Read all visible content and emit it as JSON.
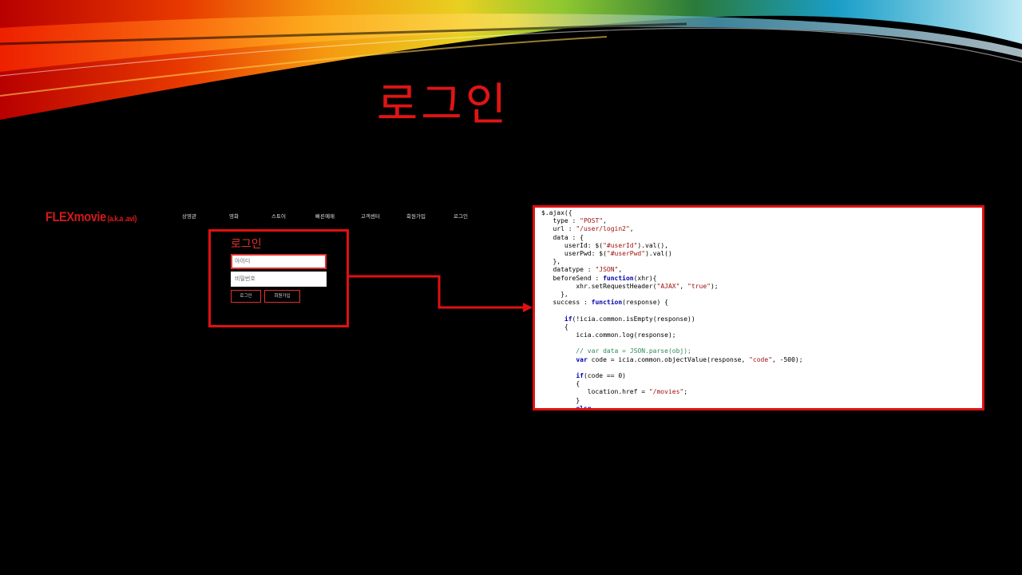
{
  "slide": {
    "title": "로그인"
  },
  "site": {
    "brand": "FLEXmovie",
    "brand_sub": "(a.k.a .avi)",
    "nav": [
      "상영관",
      "영화",
      "스토어",
      "빠른예매",
      "고객센터",
      "회원가입",
      "로그인"
    ]
  },
  "login_form": {
    "title": "로그인",
    "id_placeholder": "아이디",
    "pw_placeholder": "비밀번호",
    "login_button": "로그인",
    "signup_button": "회원가입"
  },
  "code": {
    "lines": [
      "$.ajax({",
      "   type : \"POST\",",
      "   url : \"/user/login2\",",
      "   data : {",
      "      userId: $(\"#userId\").val(),",
      "      userPwd: $(\"#userPwd\").val()",
      "   },",
      "   datatype : \"JSON\",",
      "   beforeSend : function(xhr){",
      "         xhr.setRequestHeader(\"AJAX\", \"true\");",
      "     },",
      "   success : function(response) {",
      "",
      "      if(!icia.common.isEmpty(response))",
      "      {",
      "         icia.common.log(response);",
      "",
      "         // var data = JSON.parse(obj);",
      "         var code = icia.common.objectValue(response, \"code\", -500);",
      "",
      "         if(code == 0)",
      "         {",
      "            location.href = \"/movies\";",
      "         }",
      "         else"
    ]
  },
  "colors": {
    "accent": "#e11414",
    "background": "#000000",
    "code_bg": "#ffffff"
  }
}
